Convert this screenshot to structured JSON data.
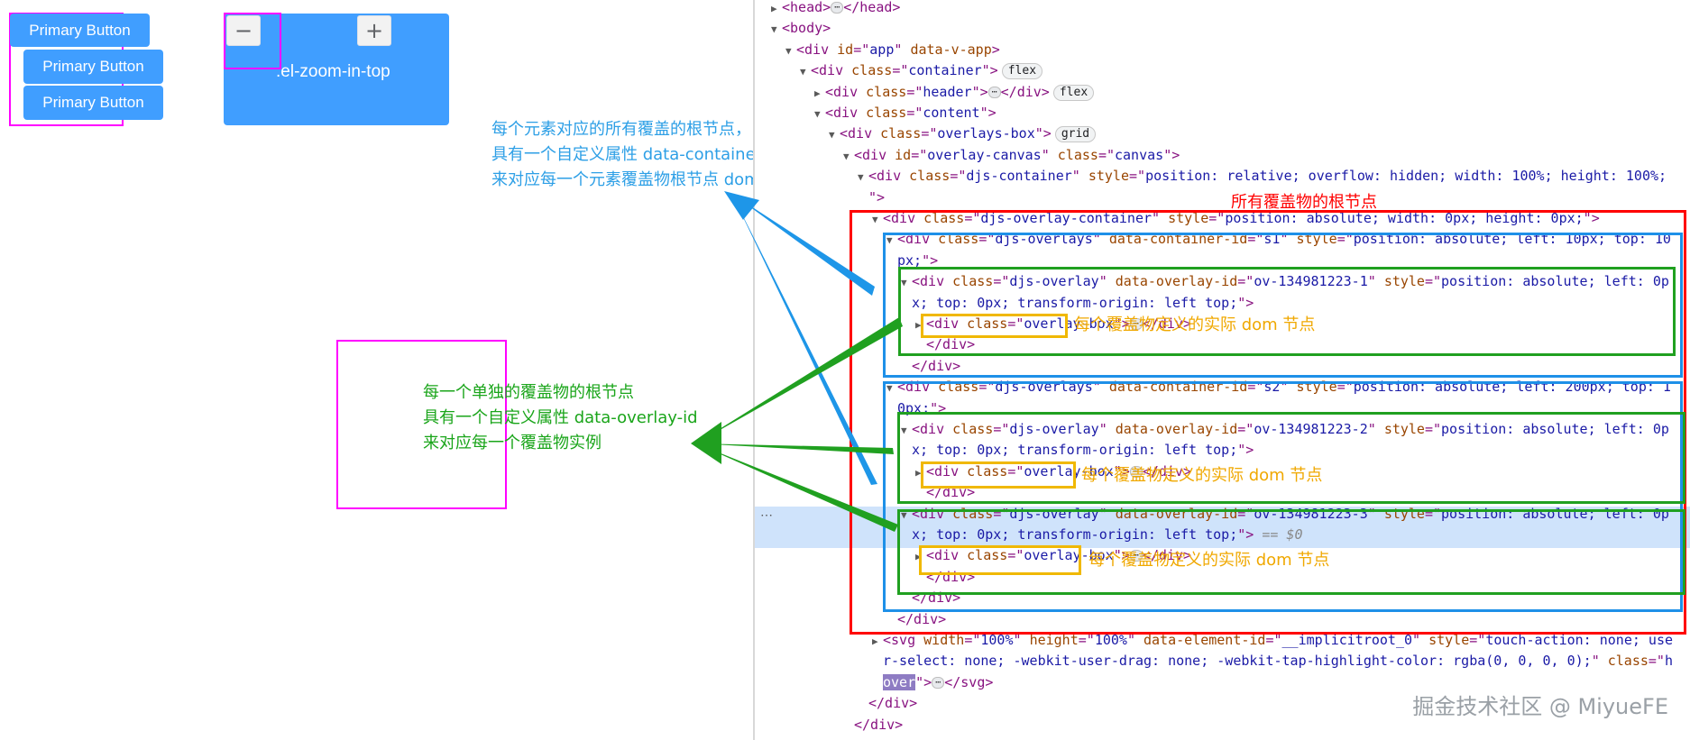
{
  "demo": {
    "buttons": [
      "Primary Button",
      "Primary Button",
      "Primary Button"
    ],
    "minus_symbol": "−",
    "plus_symbol": "+",
    "zoom_label": ".el-zoom-in-top"
  },
  "annotations": {
    "container_note": [
      "每个元素对应的所有覆盖的根节点，",
      "具有一个自定义属性 data-container-id，",
      "来对应每一个元素覆盖物根节点 dom"
    ],
    "overlay_note": [
      "每一个单独的覆盖物的根节点",
      "具有一个自定义属性 data-overlay-id",
      "来对应每一个覆盖物实例"
    ],
    "root_label": "所有覆盖物的根节点",
    "dom_label": "每个覆盖物定义的实际 dom 节点"
  },
  "devtools": {
    "flex_pill": "flex",
    "grid_pill": "grid",
    "ellipsis": "⋯",
    "selected_marker": "== $0",
    "gutter_dots": "⋯",
    "lines": [
      {
        "indent": 0,
        "arrow": "▶",
        "html": "&lt;head&gt;<span class='dots'>⋯</span>&lt;/head&gt;"
      },
      {
        "indent": 0,
        "arrow": "▼",
        "html": "&lt;body&gt;"
      },
      {
        "indent": 1,
        "arrow": "▼",
        "html": "&lt;div <span class='an'>id</span>=\"<span class='av'>app</span>\" <span class='an'>data-v-app</span>&gt;"
      },
      {
        "indent": 2,
        "arrow": "▼",
        "html": "&lt;div <span class='an'>class</span>=\"<span class='av'>container</span>\"&gt;<span class='pill'>flex</span>"
      },
      {
        "indent": 3,
        "arrow": "▶",
        "html": "&lt;div <span class='an'>class</span>=\"<span class='av'>header</span>\"&gt;<span class='dots'>⋯</span>&lt;/div&gt;<span class='pill'>flex</span>"
      },
      {
        "indent": 3,
        "arrow": "▼",
        "html": "&lt;div <span class='an'>class</span>=\"<span class='av'>content</span>\"&gt;"
      },
      {
        "indent": 4,
        "arrow": "▼",
        "html": "&lt;div <span class='an'>class</span>=\"<span class='av'>overlays-box</span>\"&gt;<span class='pill'>grid</span>"
      },
      {
        "indent": 5,
        "arrow": "▼",
        "html": "&lt;div <span class='an'>id</span>=\"<span class='av'>overlay-canvas</span>\" <span class='an'>class</span>=\"<span class='av'>canvas</span>\"&gt;"
      },
      {
        "indent": 6,
        "arrow": "▼",
        "html": "&lt;div <span class='an'>class</span>=\"<span class='av'>djs-container</span>\" <span class='an'>style</span>=\"<span class='av'>position: relative; overflow: hidden; width: 100%; height: 100%;</span>"
      },
      {
        "indent": 6,
        "arrow": "",
        "html": "\"&gt;"
      },
      {
        "indent": 7,
        "arrow": "▼",
        "html": "&lt;div <span class='an'>class</span>=\"<span class='av'>djs-overlay-container</span>\" <span class='an'>style</span>=\"<span class='av'>position: absolute; width: 0px; height: 0px;</span>\"&gt;"
      },
      {
        "indent": 8,
        "arrow": "▼",
        "html": "&lt;div <span class='an'>class</span>=\"<span class='av'>djs-overlays</span>\" <span class='an'>data-container-id</span>=\"<span class='av'>s1</span>\" <span class='an'>style</span>=\"<span class='av'>position: absolute; left: 10px; top: 10</span>"
      },
      {
        "indent": 8,
        "arrow": "",
        "html": "<span class='av'>px;</span>\"&gt;"
      },
      {
        "indent": 9,
        "arrow": "▼",
        "html": "&lt;div <span class='an'>class</span>=\"<span class='av'>djs-overlay</span>\" <span class='an'>data-overlay-id</span>=\"<span class='av'>ov-134981223-1</span>\" <span class='an'>style</span>=\"<span class='av'>position: absolute; left: 0p</span>"
      },
      {
        "indent": 9,
        "arrow": "",
        "html": "<span class='av'>x; top: 0px; transform-origin: left top;</span>\"&gt;"
      },
      {
        "indent": 10,
        "arrow": "▶",
        "html": "&lt;div <span class='an'>class</span>=\"<span class='av'>overlay-box</span>\"&gt;<span class='dots'>⋯</span>&lt;/div&gt;"
      },
      {
        "indent": 10,
        "arrow": "",
        "html": "&lt;/div&gt;"
      },
      {
        "indent": 9,
        "arrow": "",
        "html": "&lt;/div&gt;"
      },
      {
        "indent": 8,
        "arrow": "▼",
        "html": "&lt;div <span class='an'>class</span>=\"<span class='av'>djs-overlays</span>\" <span class='an'>data-container-id</span>=\"<span class='av'>s2</span>\" <span class='an'>style</span>=\"<span class='av'>position: absolute; left: 200px; top: 1</span>"
      },
      {
        "indent": 8,
        "arrow": "",
        "html": "<span class='av'>0px;</span>\"&gt;"
      },
      {
        "indent": 9,
        "arrow": "▼",
        "html": "&lt;div <span class='an'>class</span>=\"<span class='av'>djs-overlay</span>\" <span class='an'>data-overlay-id</span>=\"<span class='av'>ov-134981223-2</span>\" <span class='an'>style</span>=\"<span class='av'>position: absolute; left: 0p</span>"
      },
      {
        "indent": 9,
        "arrow": "",
        "html": "<span class='av'>x; top: 0px; transform-origin: left top;</span>\"&gt;"
      },
      {
        "indent": 10,
        "arrow": "▶",
        "html": "&lt;div <span class='an'>class</span>=\"<span class='av'>overlay-box</span>\"&gt;<span class='dots'>⋯</span>&lt;/div&gt;"
      },
      {
        "indent": 10,
        "arrow": "",
        "html": "&lt;/div&gt;"
      },
      {
        "indent": 9,
        "arrow": "▼",
        "html": "&lt;div <span class='an'>class</span>=\"<span class='av'>djs-overlay</span>\" <span class='an'>data-overlay-id</span>=\"<span class='av'>ov-134981223-3</span>\" <span class='an'>style</span>=\"<span class='av'>position: absolute; left: 0p</span>"
      },
      {
        "indent": 9,
        "arrow": "",
        "html": "<span class='av'>x; top: 0px; transform-origin: left top;</span>\"&gt; <span class='cmt'>== $0</span>"
      },
      {
        "indent": 10,
        "arrow": "▶",
        "html": "&lt;div <span class='an'>class</span>=\"<span class='av'>overlay-box</span>\"&gt;<span class='dots'>⋯</span>&lt;/div&gt;"
      },
      {
        "indent": 10,
        "arrow": "",
        "html": "&lt;/div&gt;"
      },
      {
        "indent": 9,
        "arrow": "",
        "html": "&lt;/div&gt;"
      },
      {
        "indent": 8,
        "arrow": "",
        "html": "&lt;/div&gt;"
      },
      {
        "indent": 7,
        "arrow": "▶",
        "html": "&lt;svg <span class='an'>width</span>=\"<span class='av'>100%</span>\" <span class='an'>height</span>=\"<span class='av'>100%</span>\" <span class='an'>data-element-id</span>=\"<span class='av'>__implicitroot_0</span>\" <span class='an'>style</span>=\"<span class='av'>touch-action: none; use</span>"
      },
      {
        "indent": 7,
        "arrow": "",
        "html": "<span class='av'>r-select: none; -webkit-user-drag: none; -webkit-tap-highlight-color: rgba(0, 0, 0, 0);</span>\" <span class='an'>class</span>=\"<span class='av'>h</span>"
      },
      {
        "indent": 7,
        "arrow": "",
        "html": "<span class='av' style='background:#8e7cc3;color:#fff'>over</span>\"&gt;<span class='dots'>⋯</span>&lt;/svg&gt;"
      },
      {
        "indent": 6,
        "arrow": "",
        "html": "&lt;/div&gt;"
      },
      {
        "indent": 5,
        "arrow": "",
        "html": "&lt;/div&gt;"
      }
    ]
  },
  "watermark": "掘金技术社区 @ MiyueFE"
}
